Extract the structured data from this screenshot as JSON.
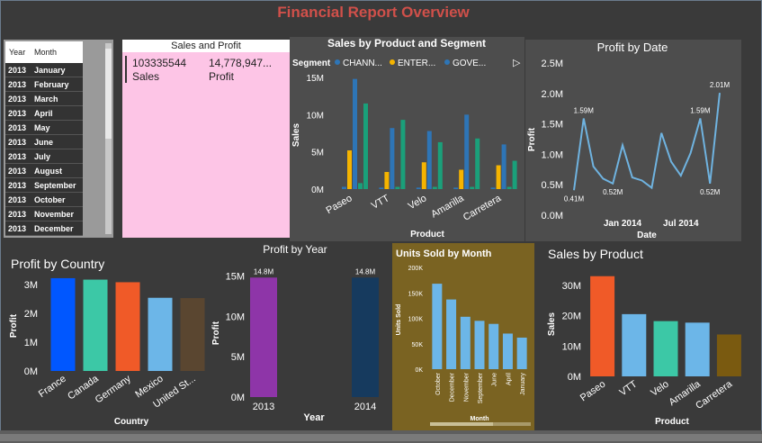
{
  "report": {
    "title": "Financial Report Overview"
  },
  "slicer": {
    "headers": [
      "Year",
      "Month"
    ],
    "rows": [
      [
        "2013",
        "January"
      ],
      [
        "2013",
        "February"
      ],
      [
        "2013",
        "March"
      ],
      [
        "2013",
        "April"
      ],
      [
        "2013",
        "May"
      ],
      [
        "2013",
        "June"
      ],
      [
        "2013",
        "July"
      ],
      [
        "2013",
        "August"
      ],
      [
        "2013",
        "September"
      ],
      [
        "2013",
        "October"
      ],
      [
        "2013",
        "November"
      ],
      [
        "2013",
        "December"
      ]
    ]
  },
  "card": {
    "title": "Sales and Profit",
    "sales_value": "103335544",
    "sales_label": "Sales",
    "profit_value": "14,778,947...",
    "profit_label": "Profit"
  },
  "colors": {
    "accent_title": "#d0504a",
    "seg_channel": "#2e75b6",
    "seg_enterprise": "#f5b400",
    "seg_government": "#1aa07a",
    "line": "#6fb3e0",
    "country_bars": [
      "#0057ff",
      "#3cc8a6",
      "#f05a28",
      "#6cb6e8",
      "#5a4630"
    ],
    "year_bars": [
      "#8e35a8",
      "#163a5e"
    ],
    "units_bar": "#6cb6e8",
    "product_bars": [
      "#f05a28",
      "#6cb6e8",
      "#3cc8a6",
      "#6cb6e8",
      "#7a5a10"
    ]
  },
  "chart_data": [
    {
      "id": "seg",
      "type": "bar",
      "title": "Sales by Product and Segment",
      "legend_title": "Segment",
      "legend_placement": "top",
      "categories": [
        "Paseo",
        "VTT",
        "Velo",
        "Amarilla",
        "Carretera"
      ],
      "series": [
        {
          "name": "CHANN...",
          "values": [
            0.3,
            0.2,
            0.2,
            0.2,
            0.2
          ]
        },
        {
          "name": "ENTER...",
          "values": [
            5.2,
            2.3,
            3.6,
            2.6,
            3.2
          ]
        },
        {
          "name": "GOVE...",
          "values": [
            14.8,
            8.2,
            7.8,
            10.0,
            6.0
          ]
        },
        {
          "name": "",
          "values": [
            0.8,
            0.3,
            0.3,
            0.3,
            0.3
          ]
        },
        {
          "name": "",
          "values": [
            11.5,
            9.3,
            6.3,
            6.8,
            3.8
          ]
        }
      ],
      "series_colors": [
        "#2e75b6",
        "#f5b400",
        "#2e75b6",
        "#1aa07a",
        "#1aa07a"
      ],
      "ylabel": "Sales",
      "xlabel": "Product",
      "yticks": [
        "0M",
        "5M",
        "10M",
        "15M"
      ],
      "ylim": [
        0,
        15
      ]
    },
    {
      "id": "date",
      "type": "line",
      "title": "Profit by Date",
      "values": [
        0.41,
        1.59,
        0.8,
        0.6,
        0.52,
        1.15,
        0.62,
        0.57,
        0.45,
        1.35,
        0.88,
        0.65,
        1.02,
        1.59,
        0.52,
        2.01
      ],
      "labels": [
        {
          "i": 0,
          "text": "0.41M"
        },
        {
          "i": 1,
          "text": "1.59M"
        },
        {
          "i": 4,
          "text": "0.52M"
        },
        {
          "i": 13,
          "text": "1.59M"
        },
        {
          "i": 14,
          "text": "0.52M"
        },
        {
          "i": 15,
          "text": "2.01M"
        }
      ],
      "xticks": [
        {
          "pos": 5,
          "text": "Jan 2014"
        },
        {
          "pos": 11,
          "text": "Jul 2014"
        }
      ],
      "yticks": [
        "0.0M",
        "0.5M",
        "1.0M",
        "1.5M",
        "2.0M",
        "2.5M"
      ],
      "ylabel": "Profit",
      "xlabel": "Date",
      "ylim": [
        0,
        2.5
      ]
    },
    {
      "id": "country",
      "type": "bar",
      "title": "Profit by Country",
      "categories": [
        "France",
        "Canada",
        "Germany",
        "Mexico",
        "United St..."
      ],
      "values": [
        3.22,
        3.17,
        3.08,
        2.54,
        2.53
      ],
      "ylabel": "Profit",
      "xlabel": "Country",
      "yticks": [
        "0M",
        "1M",
        "2M",
        "3M"
      ],
      "ylim": [
        0,
        3.5
      ]
    },
    {
      "id": "year",
      "type": "bar",
      "title": "Profit by Year",
      "categories": [
        "2013",
        "2014"
      ],
      "values": [
        14.8,
        14.8
      ],
      "data_labels": [
        "14.8M",
        "14.8M"
      ],
      "ylabel": "Profit",
      "xlabel": "Year",
      "yticks": [
        "0M",
        "5M",
        "10M",
        "15M"
      ],
      "ylim": [
        0,
        15.5
      ]
    },
    {
      "id": "units",
      "type": "bar",
      "title": "Units Sold by Month",
      "categories": [
        "October",
        "December",
        "November",
        "September",
        "June",
        "April",
        "January"
      ],
      "values": [
        168,
        137,
        103,
        95,
        89,
        70,
        62
      ],
      "ylabel": "Units Sold",
      "xlabel": "Month",
      "yticks": [
        "0K",
        "50K",
        "100K",
        "150K",
        "200K"
      ],
      "ylim": [
        0,
        200
      ]
    },
    {
      "id": "product",
      "type": "bar",
      "title": "Sales by Product",
      "categories": [
        "Paseo",
        "VTT",
        "Velo",
        "Amarilla",
        "Carretera"
      ],
      "values": [
        33,
        20.5,
        18.2,
        17.7,
        13.8
      ],
      "ylabel": "Sales",
      "xlabel": "Product",
      "yticks": [
        "0M",
        "10M",
        "20M",
        "30M"
      ],
      "ylim": [
        0,
        35
      ]
    }
  ]
}
